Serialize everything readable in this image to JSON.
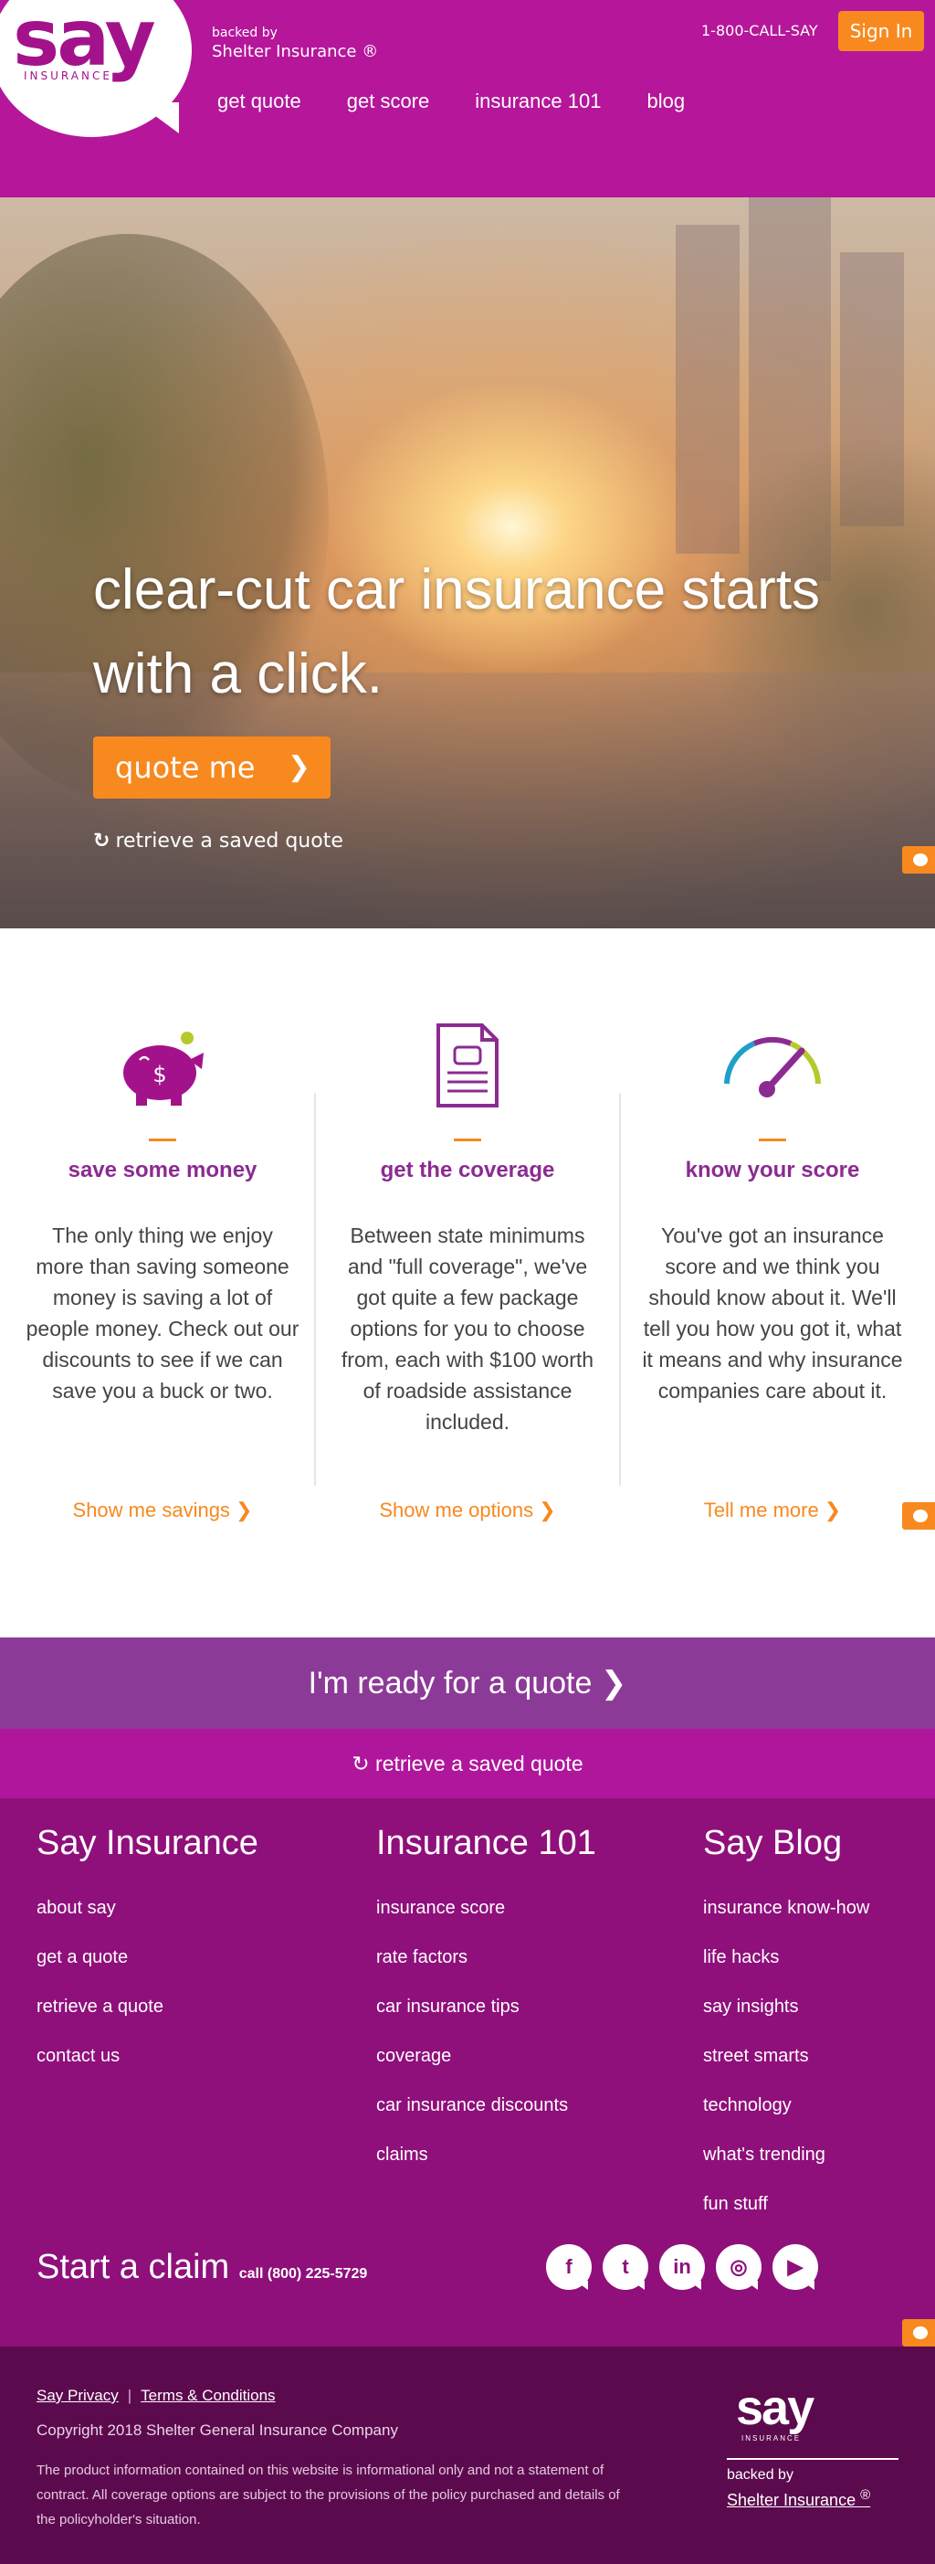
{
  "header": {
    "logo": "say",
    "logo_sub": "INSURANCE",
    "backed_by": "backed by",
    "backer": "Shelter Insurance ®",
    "phone": "1-800-CALL-SAY",
    "sign_in": "Sign In",
    "nav": [
      "get quote",
      "get score",
      "insurance 101",
      "blog"
    ]
  },
  "hero": {
    "headline": "clear-cut car insurance starts with a click.",
    "cta": "quote me",
    "cta_chevron": "❯",
    "retrieve": "retrieve a saved quote"
  },
  "features": [
    {
      "icon": "piggy-bank-icon",
      "title": "save some money",
      "body": "The only thing we enjoy more than saving someone money is saving a lot of people money. Check out our discounts to see if we can save you a buck or two.",
      "link": "Show me savings ❯"
    },
    {
      "icon": "document-car-icon",
      "title": "get the coverage",
      "body": "Between state minimums and \"full coverage\", we've got quite a few package options for you to choose from, each with $100 worth of roadside assistance included.",
      "link": "Show me options ❯"
    },
    {
      "icon": "speedometer-icon",
      "title": "know your score",
      "body": "You've got an insurance score and we think you should know about it. We'll tell you how you got it, what it means and why insurance companies care about it.",
      "link": "Tell me more ❯"
    }
  ],
  "cta_bar": {
    "ready": "I'm ready for a quote ❯",
    "retrieve": "retrieve a saved quote"
  },
  "footer": {
    "col1": {
      "heading": "Say Insurance",
      "links": [
        "about say",
        "get a quote",
        "retrieve a quote",
        "contact us"
      ]
    },
    "col2": {
      "heading": "Insurance 101",
      "links": [
        "insurance score",
        "rate factors",
        "car insurance tips",
        "coverage",
        "car insurance discounts",
        "claims"
      ]
    },
    "col3": {
      "heading": "Say Blog",
      "links": [
        "insurance know-how",
        "life hacks",
        "say insights",
        "street smarts",
        "technology",
        "what's trending",
        "fun stuff"
      ]
    },
    "claim": "Start a claim",
    "claim_call": "call (800) 225-5729",
    "socials": [
      "facebook-icon",
      "twitter-icon",
      "linkedin-icon",
      "instagram-icon",
      "youtube-icon"
    ]
  },
  "bottom": {
    "privacy": "Say Privacy",
    "terms": "Terms & Conditions",
    "copyright": "Copyright 2018 Shelter General Insurance Company",
    "disclaimer": "The product information contained on this website is informational only and not a statement of contract. All coverage options are subject to the provisions of the policy purchased and details of the policyholder's situation.",
    "logo": "say",
    "logo_sub": "INSURANCE",
    "backed_by": "backed by",
    "backer": "Shelter Insurance",
    "reg": "®"
  },
  "colors": {
    "brand_magenta": "#b5169a",
    "accent_orange": "#f7891f",
    "footer_purple": "#8f0f7b",
    "cta_purple": "#8c3a97"
  }
}
